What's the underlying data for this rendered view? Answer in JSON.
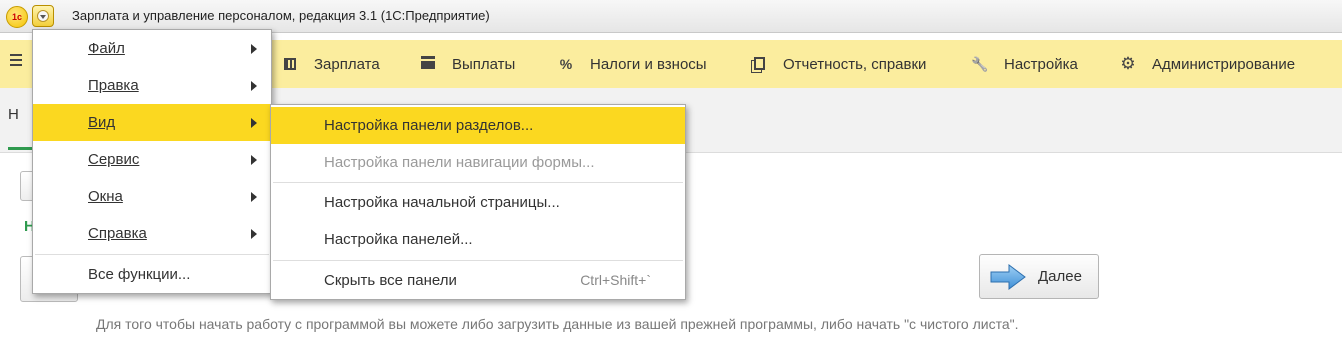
{
  "window": {
    "logo_text": "1с",
    "title": "Зарплата и управление персоналом, редакция 3.1  (1С:Предприятие)"
  },
  "sections": [
    {
      "label": "Зарплата",
      "icon": "calculator-icon"
    },
    {
      "label": "Выплаты",
      "icon": "card-icon"
    },
    {
      "label": "Налоги и взносы",
      "icon": "percent-icon",
      "glyph": "%"
    },
    {
      "label": "Отчетность, справки",
      "icon": "documents-icon"
    },
    {
      "label": "Настройка",
      "icon": "wrench-icon",
      "glyph": "🔧"
    },
    {
      "label": "Администрирование",
      "icon": "gear-icon",
      "glyph": "⚙"
    }
  ],
  "tabs": {
    "active_label": "Н"
  },
  "content": {
    "green_heading": "Н",
    "next_button_label": "Далее",
    "hint": "Для того чтобы начать работу с программой вы можете либо загрузить данные из вашей прежней программы, либо начать \"с чистого листа\"."
  },
  "main_menu": {
    "items": [
      {
        "label": "Файл",
        "has_submenu": true
      },
      {
        "label": "Правка",
        "has_submenu": true
      },
      {
        "label": "Вид",
        "has_submenu": true,
        "highlighted": true
      },
      {
        "label": "Сервис",
        "has_submenu": true
      },
      {
        "label": "Окна",
        "has_submenu": true
      },
      {
        "label": "Справка",
        "has_submenu": true
      },
      {
        "label": "Все функции...",
        "has_submenu": false
      }
    ]
  },
  "view_submenu": {
    "items": [
      {
        "label": "Настройка панели разделов...",
        "highlighted": true,
        "enabled": true
      },
      {
        "label": "Настройка панели навигации формы...",
        "enabled": false
      },
      {
        "label": "Настройка начальной страницы...",
        "enabled": true
      },
      {
        "label": "Настройка панелей...",
        "enabled": true
      },
      {
        "label": "Скрыть все панели",
        "shortcut": "Ctrl+Shift+`",
        "enabled": true
      }
    ]
  },
  "colors": {
    "accent_yellow": "#fbd820",
    "sections_bg": "#fbed9e",
    "green": "#2f9a4e"
  }
}
